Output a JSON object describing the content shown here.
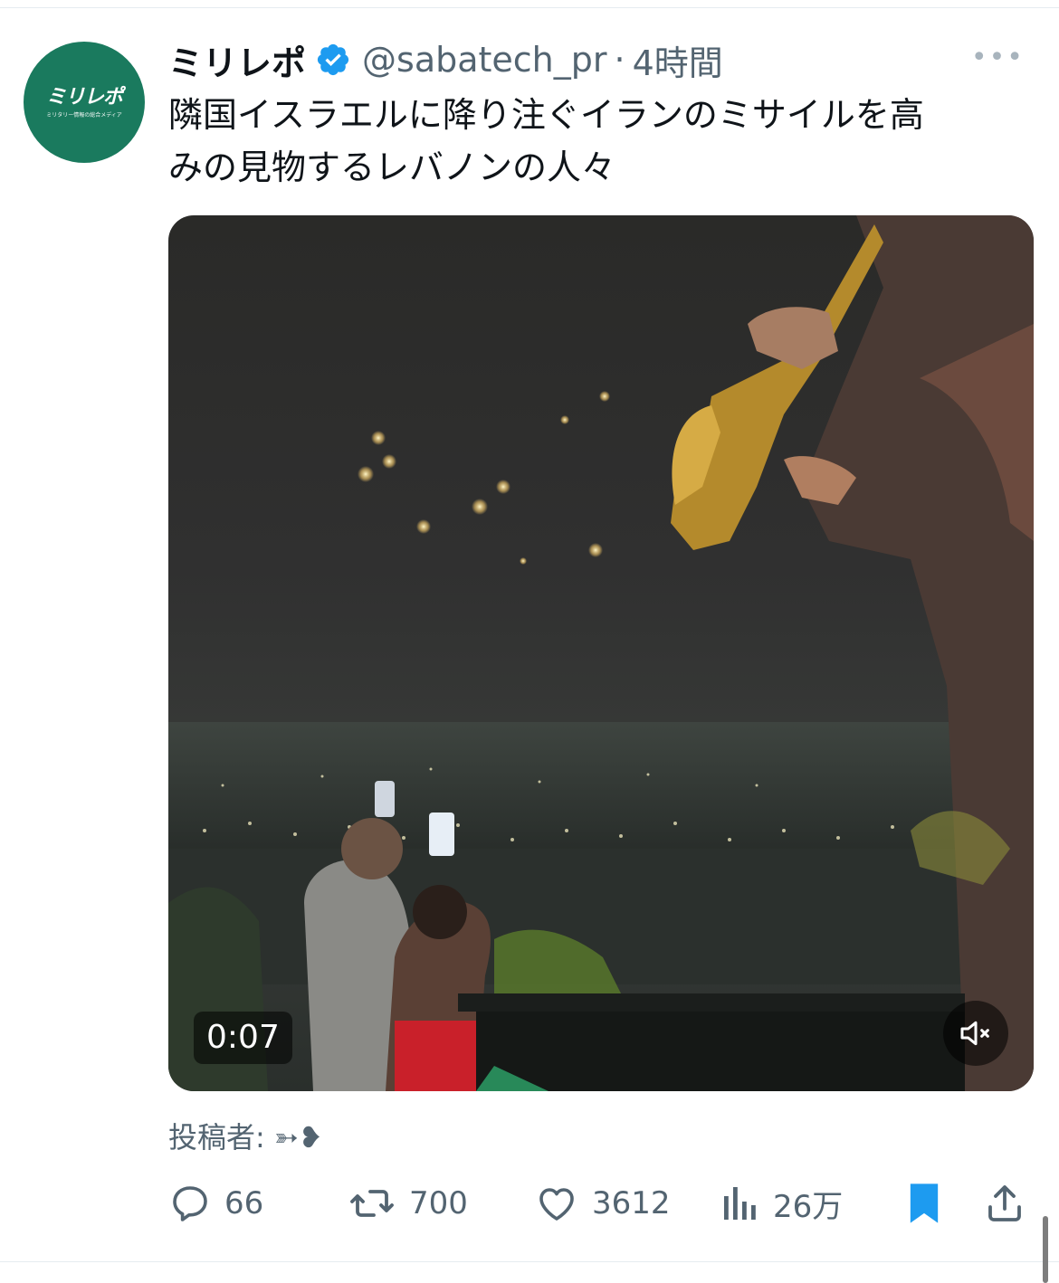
{
  "account": {
    "name": "ミリレポ",
    "handle": "@sabatech_pr",
    "separator": "·",
    "time": "4時間",
    "avatar_logo": "ミリレポ",
    "avatar_tagline": "ミリタリー情報の総合メディア",
    "avatar_color": "#1a7a5e",
    "verified_color": "#1d9bf0"
  },
  "more_label": "•••",
  "tweet_text": "隣国イスラエルに降り注ぐイランのミサイルを高\nみの見物するレバノンの人々",
  "video": {
    "duration": "0:07",
    "mute_icon": "speaker-muted-icon"
  },
  "credit": "投稿者: ➳❥",
  "actions": {
    "reply_count": "66",
    "retweet_count": "700",
    "like_count": "3612",
    "views_count": "26万",
    "bookmark_color": "#1d9bf0"
  }
}
